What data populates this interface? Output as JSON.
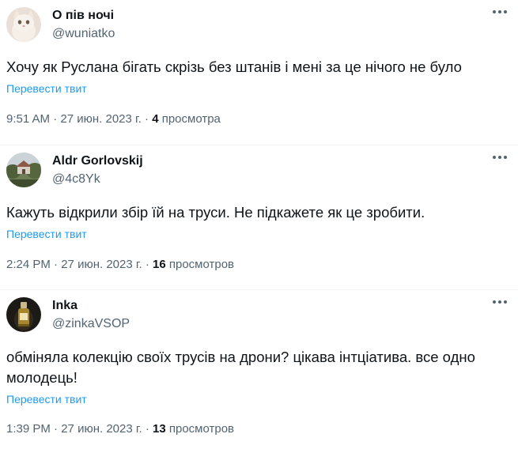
{
  "tweets": [
    {
      "display_name": "О пів ночі",
      "handle": "@wuniatko",
      "text": "Хочу як Руслана бігать скрізь без штанів і мені за це нічого не було",
      "translate_label": "Перевести твит",
      "time": "9:51 AM",
      "date": "27 июн. 2023 г.",
      "separator": "·",
      "views_count": "4",
      "views_label": "просмотра",
      "avatar": "cat-photo"
    },
    {
      "display_name": "Aldr Gorlovskij",
      "handle": "@4c8Yk",
      "text": "Кажуть відкрили збір їй на труси. Не підкажете як це зробити.",
      "translate_label": "Перевести твит",
      "time": "2:24 PM",
      "date": "27 июн. 2023 г.",
      "separator": "·",
      "views_count": "16",
      "views_label": "просмотров",
      "avatar": "landscape-photo"
    },
    {
      "display_name": "Inka",
      "handle": "@zinkaVSOP",
      "text": "обміняла колекцію своїх трусів на дрони? цікава інтціатива. все одно молодець!",
      "translate_label": "Перевести твит",
      "time": "1:39 PM",
      "date": "27 июн. 2023 г.",
      "separator": "·",
      "views_count": "13",
      "views_label": "просмотров",
      "avatar": "bottle-photo"
    }
  ],
  "icons": {
    "more": "more-dots-icon"
  },
  "colors": {
    "text": "#0f1419",
    "secondary": "#536471",
    "link": "#1d9bf0",
    "divider": "#eff3f4"
  }
}
